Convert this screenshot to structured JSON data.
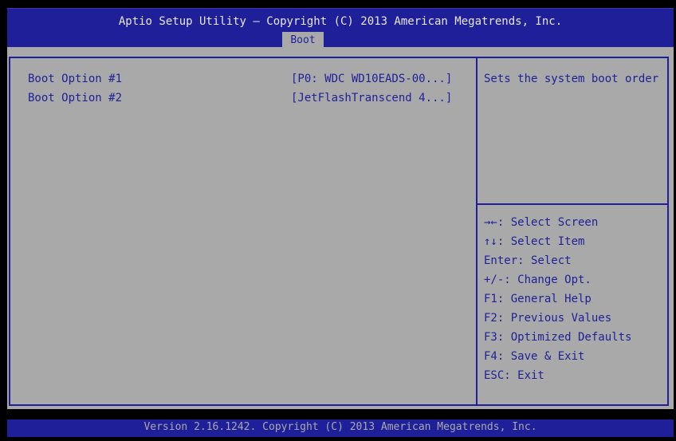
{
  "header": {
    "title": "Aptio Setup Utility – Copyright (C) 2013 American Megatrends, Inc.",
    "tabs": [
      {
        "label": "Boot",
        "active": true
      }
    ]
  },
  "boot_options": [
    {
      "label": "Boot Option #1",
      "value": "[P0: WDC WD10EADS-00...]"
    },
    {
      "label": "Boot Option #2",
      "value": "[JetFlashTranscend 4...]"
    }
  ],
  "help": {
    "description": "Sets the system boot order"
  },
  "key_legend": [
    "→←: Select Screen",
    "↑↓: Select Item",
    "Enter: Select",
    "+/-: Change Opt.",
    "F1: General Help",
    "F2: Previous Values",
    "F3: Optimized Defaults",
    "F4: Save & Exit",
    "ESC: Exit"
  ],
  "footer": {
    "text": "Version 2.16.1242. Copyright (C) 2013 American Megatrends, Inc."
  },
  "colors": {
    "bios_blue": "#1f1f99",
    "bios_gray": "#a9a9a9",
    "header_text": "#e8e8e8"
  }
}
